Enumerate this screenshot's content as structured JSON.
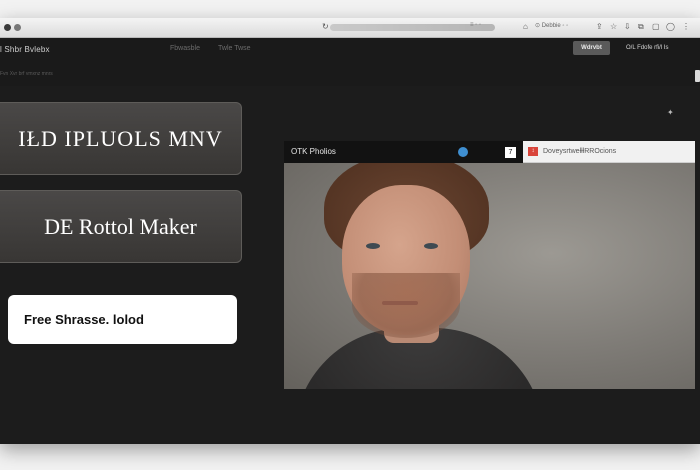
{
  "browser": {
    "url_text": "≡ ◦ ◦",
    "search_text": "⊙ Debbie ◦ ◦",
    "icons": [
      "close-icon",
      "reload-icon",
      "share-icon",
      "settings-icon"
    ]
  },
  "app": {
    "brand": "l Shbr Bvlebx",
    "nav": [
      "Fbwasble",
      "Twle Twse"
    ],
    "sub_link": "Fvn Xvr brf vmxnz mnrs",
    "primary_button": "Wdrvbt",
    "secondary_link": "O/L Fdofe rfi/l Is"
  },
  "cards": {
    "card1": "IŁD IPLUOLS MNV",
    "card2": "DE Rottol Maker",
    "card3": "Free Shrasse. lolod"
  },
  "photo_panel": {
    "title": "OTK Pholios",
    "square_button": "7",
    "tab_label": "DoveysrtwełłłRROcions",
    "tab_icon_text": "↕"
  },
  "colors": {
    "window_bg": "#1c1c1c",
    "card_dark": "#3e3c3a",
    "accent_blue": "#3f8fd1",
    "tab_red": "#d9453b"
  }
}
